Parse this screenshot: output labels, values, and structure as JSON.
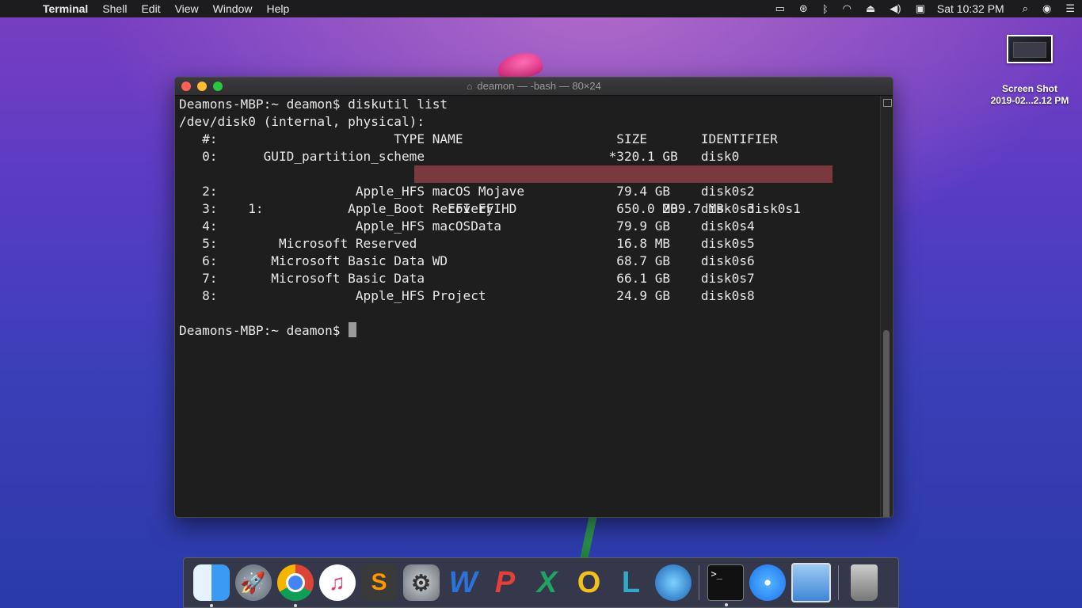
{
  "menubar": {
    "app_name": "Terminal",
    "menus": [
      "Shell",
      "Edit",
      "View",
      "Window",
      "Help"
    ],
    "clock": "Sat 10:32 PM",
    "status_icons": [
      "display-icon",
      "accessibility-icon",
      "bluetooth-icon",
      "wifi-icon",
      "eject-icon",
      "volume-icon",
      "input-menu-icon",
      "spotlight-icon",
      "siri-icon",
      "notification-center-icon"
    ]
  },
  "desktop": {
    "file_label_line1": "Screen Shot",
    "file_label_line2": "2019-02...2.12 PM"
  },
  "terminal": {
    "window_title": "deamon — -bash — 80×24",
    "lines": {
      "l0": "Deamons-MBP:~ deamon$ diskutil list",
      "l1": "/dev/disk0 (internal, physical):",
      "l2": "   #:                       TYPE NAME                    SIZE       IDENTIFIER",
      "l3": "   0:      GUID_partition_scheme                        *320.1 GB   disk0",
      "l4": "   1:                        EFI EFI                     209.7 MB   disk0s1",
      "l5": "   2:                  Apple_HFS macOS Mojave            79.4 GB    disk0s2",
      "l6": "   3:                 Apple_Boot Recovery HD             650.0 MB   disk0s3",
      "l7": "   4:                  Apple_HFS macOSData               79.9 GB    disk0s4",
      "l8": "   5:        Microsoft Reserved                          16.8 MB    disk0s5",
      "l9": "   6:       Microsoft Basic Data WD                      68.7 GB    disk0s6",
      "l10": "   7:       Microsoft Basic Data                         66.1 GB    disk0s7",
      "l11": "   8:                  Apple_HFS Project                 24.9 GB    disk0s8",
      "l12": "",
      "l13": "Deamons-MBP:~ deamon$ "
    },
    "highlight_color": "#7a3a3d"
  },
  "dock": {
    "items": [
      {
        "name": "finder-icon",
        "glyph": ""
      },
      {
        "name": "launchpad-icon",
        "glyph": "🚀"
      },
      {
        "name": "chrome-icon",
        "glyph": ""
      },
      {
        "name": "itunes-icon",
        "glyph": "♫"
      },
      {
        "name": "sublime-text-icon",
        "glyph": "S"
      },
      {
        "name": "system-preferences-icon",
        "glyph": "⚙"
      },
      {
        "name": "word-icon",
        "glyph": "W"
      },
      {
        "name": "powerpoint-icon",
        "glyph": "P"
      },
      {
        "name": "excel-icon",
        "glyph": "X"
      },
      {
        "name": "outlook-icon",
        "glyph": "O"
      },
      {
        "name": "lync-icon",
        "glyph": "L"
      },
      {
        "name": "globe-download-icon",
        "glyph": ""
      },
      {
        "name": "terminal-icon",
        "glyph": ">_"
      },
      {
        "name": "safari-icon",
        "glyph": ""
      },
      {
        "name": "preview-icon",
        "glyph": ""
      },
      {
        "name": "trash-icon",
        "glyph": ""
      }
    ]
  }
}
